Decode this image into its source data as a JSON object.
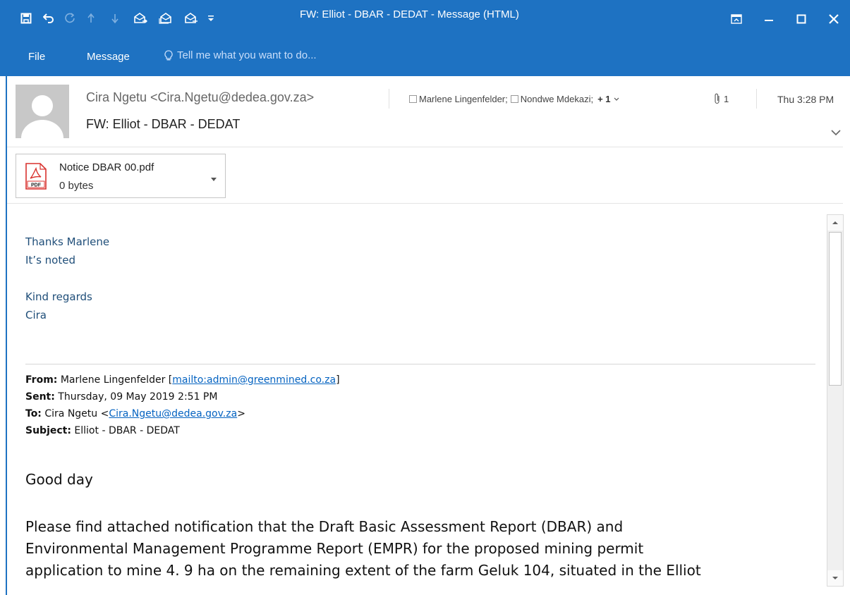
{
  "window": {
    "title": "FW: Elliot - DBAR - DEDAT - Message (HTML)"
  },
  "quick_access": {
    "icons": [
      "save-icon",
      "undo-icon",
      "redo-icon",
      "previous-item-icon",
      "next-item-icon",
      "reply-icon",
      "reply-all-icon",
      "forward-icon",
      "customize-toolbar-icon"
    ]
  },
  "menu": {
    "file": "File",
    "message": "Message",
    "tell_me": "Tell me what you want to do..."
  },
  "header": {
    "sender": "Cira Ngetu <Cira.Ngetu@dedea.gov.za>",
    "recipient_1": "Marlene Lingenfelder;",
    "recipient_2": "Nondwe Mdekazi;",
    "more_recipients": "+ 1",
    "attachment_count": "1",
    "date": "Thu 3:28 PM",
    "subject": "FW: Elliot - DBAR - DEDAT"
  },
  "attachment": {
    "name": "Notice DBAR 00.pdf",
    "size": "0 bytes",
    "icon_label": "PDF"
  },
  "body": {
    "reply_line1": "Thanks Marlene",
    "reply_line2": "It’s noted",
    "reply_line3": "Kind regards",
    "reply_line4": "Cira",
    "from_label": "From:",
    "from_name": "Marlene Lingenfelder [",
    "from_link": "mailto:admin@greenmined.co.za",
    "from_close": "]",
    "sent_label": "Sent:",
    "sent_value": "Thursday, 09 May 2019 2:51 PM",
    "to_label": "To:",
    "to_name": "Cira Ngetu <",
    "to_link": "Cira.Ngetu@dedea.gov.za",
    "to_close": ">",
    "subject_label": "Subject:",
    "subject_value": "Elliot - DBAR - DEDAT",
    "greeting": "Good day",
    "paragraph": "Please find attached notification that the Draft Basic Assessment Report (DBAR) and\nEnvironmental Management Programme Report (EMPR) for the proposed mining permit\napplication to mine 4. 9 ha on the remaining extent of the farm Geluk 104, situated in the Elliot"
  },
  "colors": {
    "accent": "#1e72c2",
    "reply_text": "#1f4e79",
    "link": "#0563c1"
  }
}
